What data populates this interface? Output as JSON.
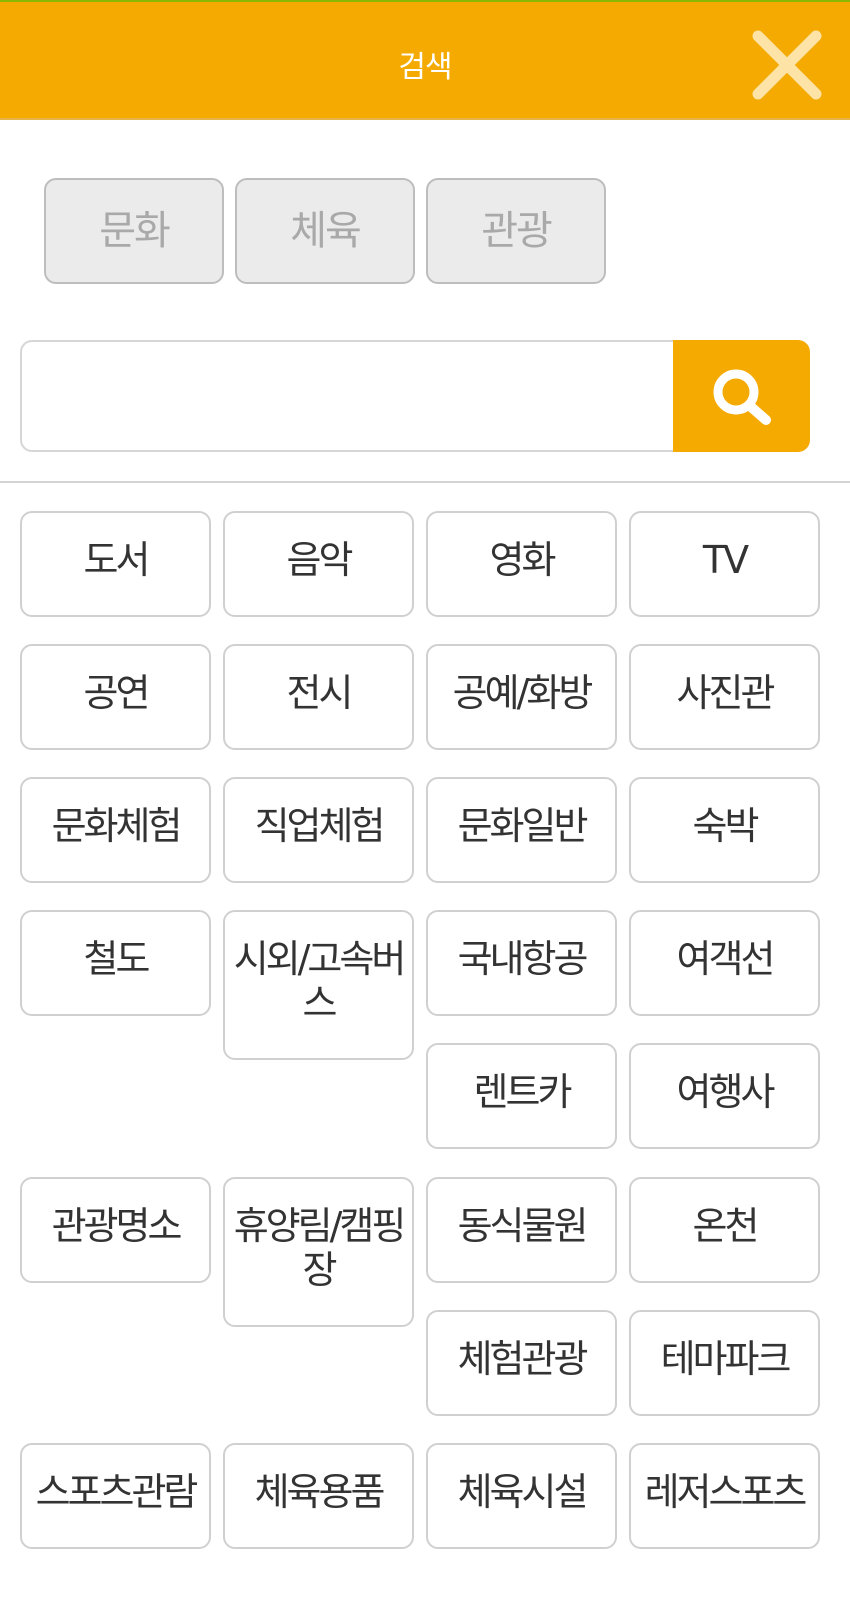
{
  "header": {
    "title": "검색",
    "close_icon": "close-icon"
  },
  "tabs": [
    {
      "label": "문화"
    },
    {
      "label": "체육"
    },
    {
      "label": "관광"
    }
  ],
  "search": {
    "value": "",
    "placeholder": "",
    "button_icon": "search-icon"
  },
  "colors": {
    "accent": "#f4aa00",
    "tab_bg": "#ebebeb",
    "tab_text": "#a9a9a9",
    "text": "#333333",
    "border": "#d0d0d0"
  },
  "categories": [
    {
      "label": "도서"
    },
    {
      "label": "음악"
    },
    {
      "label": "영화"
    },
    {
      "label": "TV"
    },
    {
      "label": "공연"
    },
    {
      "label": "전시"
    },
    {
      "label": "공예/화방"
    },
    {
      "label": "사진관"
    },
    {
      "label": "문화체험"
    },
    {
      "label": "직업체험"
    },
    {
      "label": "문화일반"
    },
    {
      "label": "숙박"
    },
    {
      "label": "철도"
    },
    {
      "label": "시외/고속버스"
    },
    {
      "label": "국내항공"
    },
    {
      "label": "여객선"
    },
    {
      "label": "렌트카"
    },
    {
      "label": "여행사"
    },
    {
      "label": "관광명소"
    },
    {
      "label": "휴양림/캠핑장"
    },
    {
      "label": "동식물원"
    },
    {
      "label": "온천"
    },
    {
      "label": "체험관광"
    },
    {
      "label": "테마파크"
    },
    {
      "label": "스포츠관람"
    },
    {
      "label": "체육용품"
    },
    {
      "label": "체육시설"
    },
    {
      "label": "레저스포츠"
    }
  ]
}
